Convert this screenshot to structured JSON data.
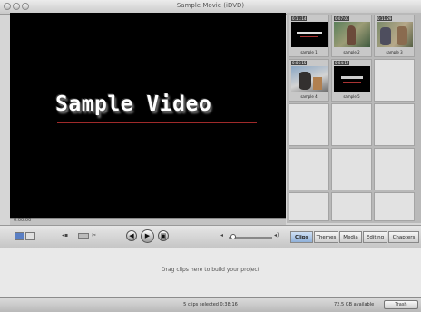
{
  "window": {
    "title": "Sample Movie (iDVD)"
  },
  "viewer": {
    "overlay_text": "Sample Video"
  },
  "clips": [
    {
      "duration": "0:11:14",
      "label": "sample 1"
    },
    {
      "duration": "0:07:03",
      "label": "sample 2"
    },
    {
      "duration": "0:11:29",
      "label": "sample 3"
    },
    {
      "duration": "0:06:15",
      "label": "sample 4"
    },
    {
      "duration": "0:04:15",
      "label": "sample 5"
    }
  ],
  "scrubber": {
    "label": "0:00:00"
  },
  "tabs": [
    "Clips",
    "Themes",
    "Media",
    "Editing",
    "Chapters"
  ],
  "tabs_active": "Clips",
  "droparea": {
    "hint": "Drag clips here to build your project"
  },
  "status": {
    "center": "5 clips selected  0:38:16",
    "right": "72.5 GB available",
    "trash_label": "Trash"
  },
  "colors": {
    "accent_tab": "#8fb0d8",
    "viewer_bg": "#000000"
  }
}
